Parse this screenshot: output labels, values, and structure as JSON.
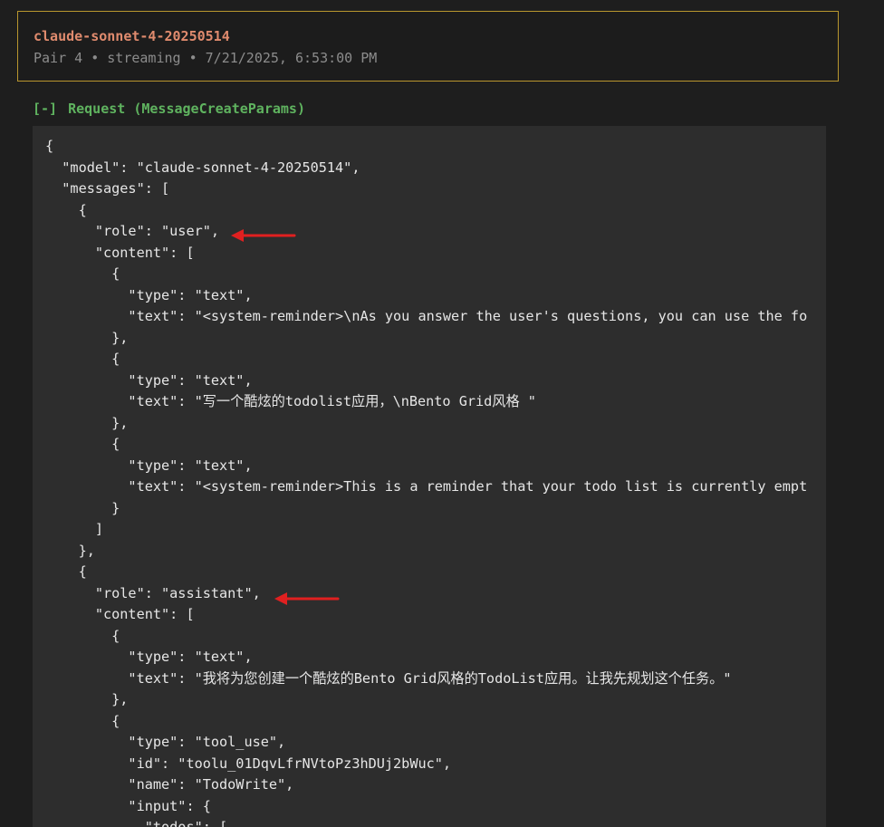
{
  "header": {
    "model_name": "claude-sonnet-4-20250514",
    "meta": "Pair 4 • streaming • 7/21/2025, 6:53:00 PM"
  },
  "request_section": {
    "toggle": "[-]",
    "title": "Request (MessageCreateParams)"
  },
  "code": {
    "lines": [
      "{",
      "  \"model\": \"claude-sonnet-4-20250514\",",
      "  \"messages\": [",
      "    {",
      "      \"role\": \"user\",",
      "      \"content\": [",
      "        {",
      "          \"type\": \"text\",",
      "          \"text\": \"<system-reminder>\\nAs you answer the user's questions, you can use the fo",
      "        },",
      "        {",
      "          \"type\": \"text\",",
      "          \"text\": \"写一个酷炫的todolist应用，\\nBento Grid风格 \"",
      "        },",
      "        {",
      "          \"type\": \"text\",",
      "          \"text\": \"<system-reminder>This is a reminder that your todo list is currently empt",
      "        }",
      "      ]",
      "    },",
      "    {",
      "      \"role\": \"assistant\",",
      "      \"content\": [",
      "        {",
      "          \"type\": \"text\",",
      "          \"text\": \"我将为您创建一个酷炫的Bento Grid风格的TodoList应用。让我先规划这个任务。\"",
      "        },",
      "        {",
      "          \"type\": \"tool_use\",",
      "          \"id\": \"toolu_01DqvLfrNVtoPz3hDUj2bWuc\",",
      "          \"name\": \"TodoWrite\",",
      "          \"input\": {",
      "            \"todos\": ["
    ]
  },
  "annotations": {
    "arrow_color": "#e02020"
  }
}
